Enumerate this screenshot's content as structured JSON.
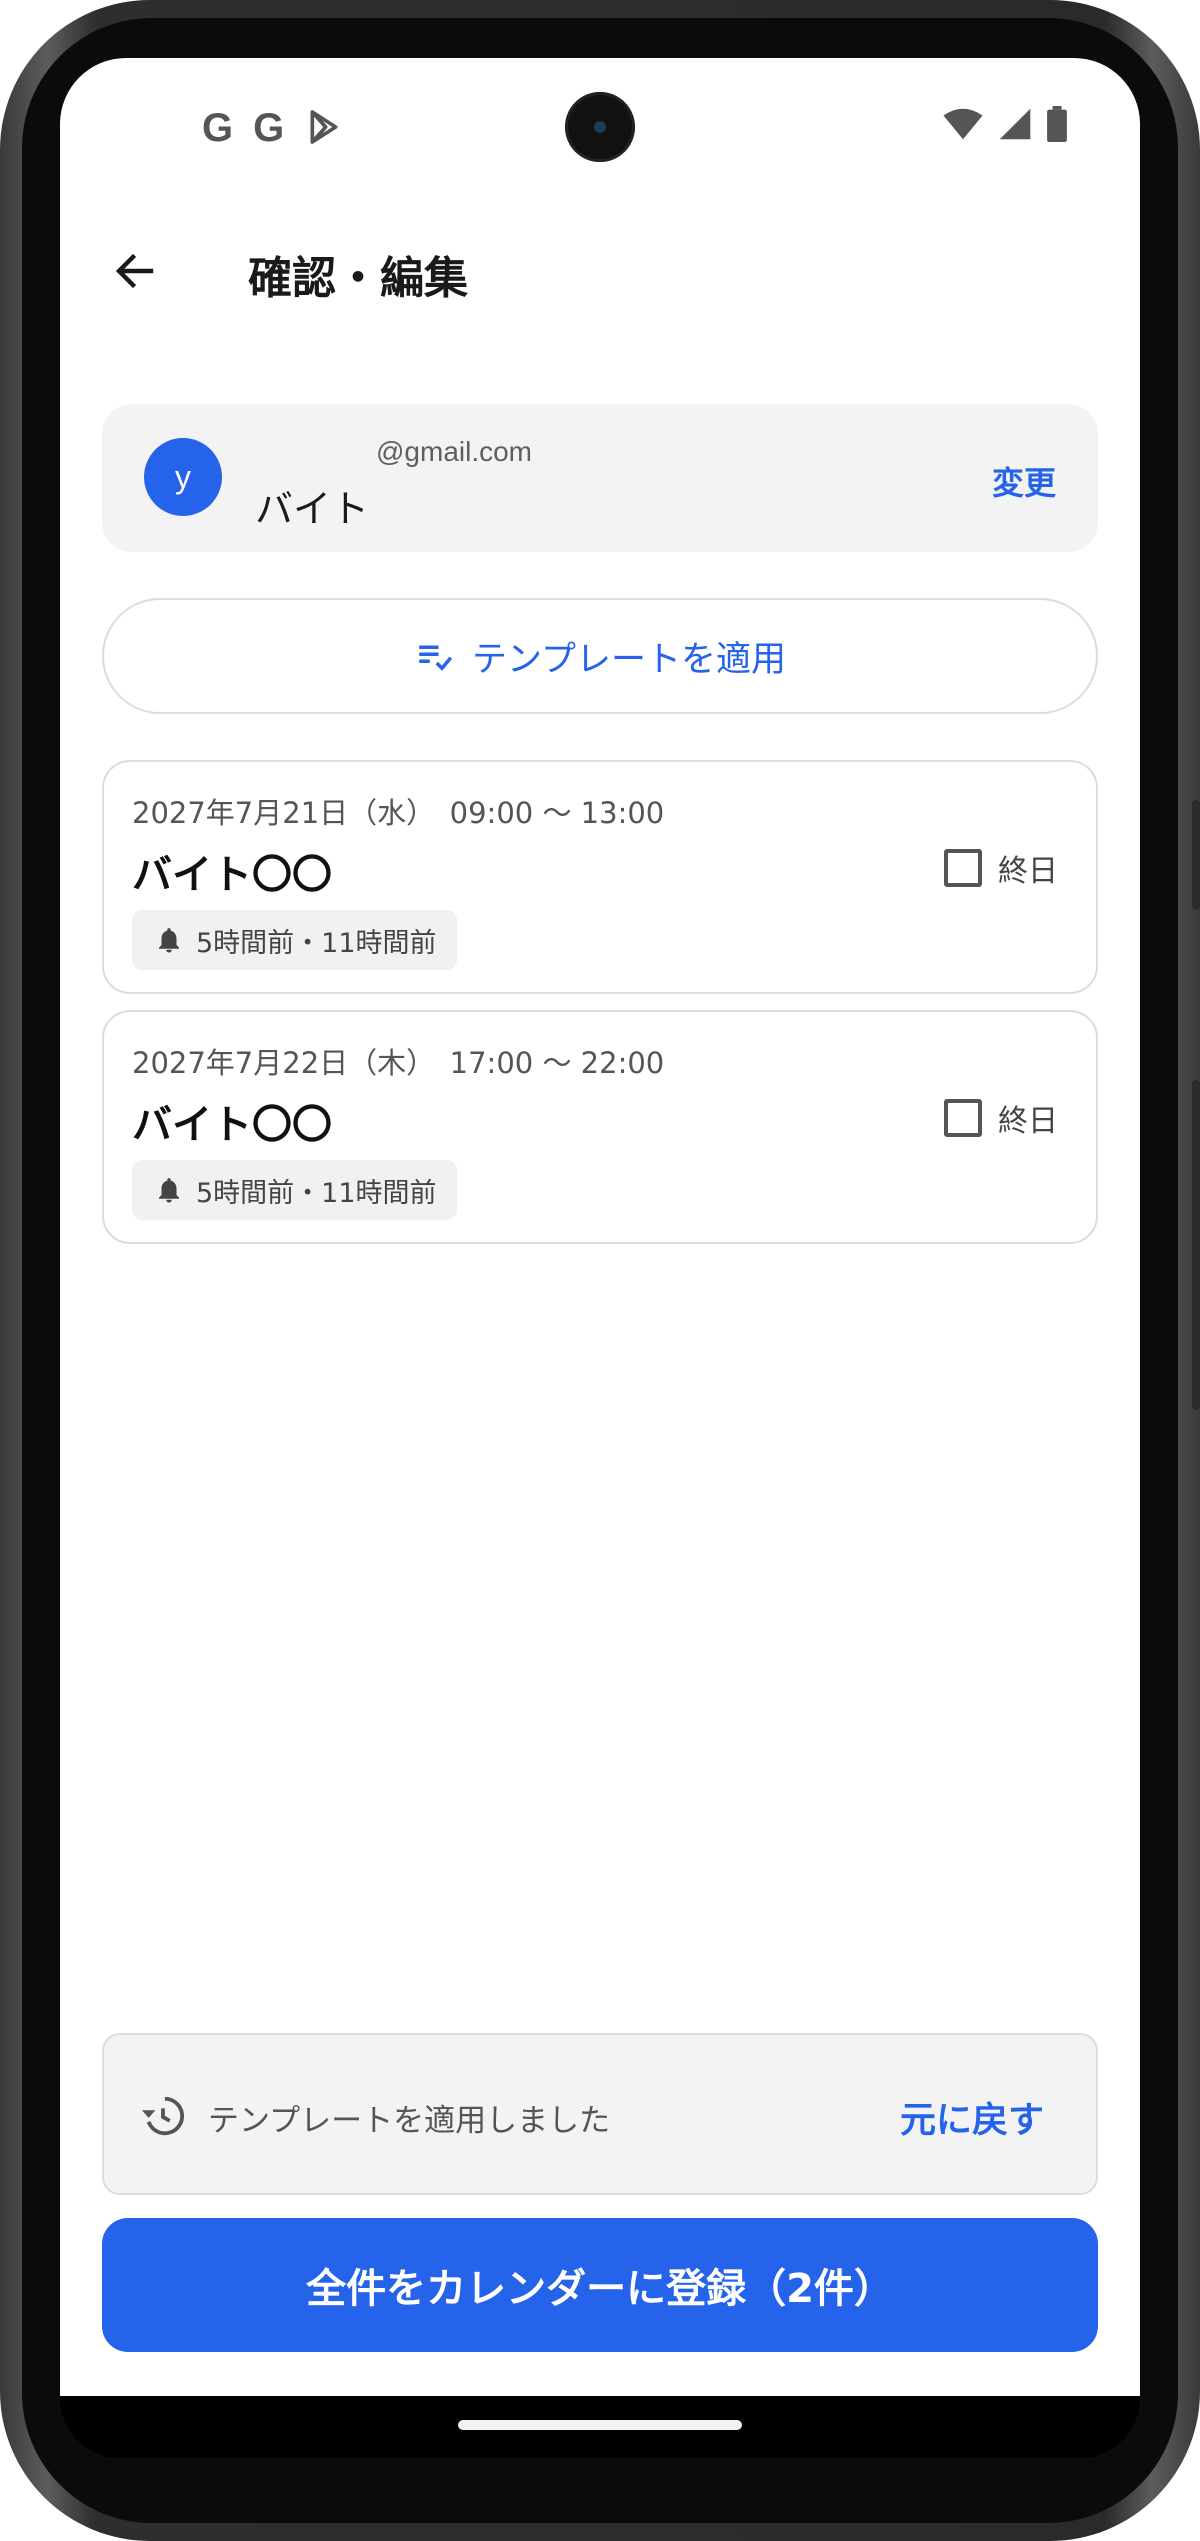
{
  "status_bar": {
    "left_icons": [
      "google-icon",
      "google-icon",
      "play-store-icon"
    ],
    "right_icons": [
      "wifi-icon",
      "signal-icon",
      "battery-icon"
    ]
  },
  "app_bar": {
    "title": "確認・編集",
    "back_icon": "arrow-back-icon"
  },
  "account": {
    "avatar_letter": "y",
    "email": "@gmail.com",
    "calendar_name": "バイト",
    "change_label": "変更"
  },
  "template_button": {
    "label": "テンプレートを適用",
    "icon": "checklist-icon"
  },
  "events": [
    {
      "datetime": "2027年7月21日（水）　09:00 〜 13:00",
      "title": "バイト〇〇",
      "allday_label": "終日",
      "allday_checked": false,
      "reminder": "5時間前・11時間前"
    },
    {
      "datetime": "2027年7月22日（木）　17:00 〜 22:00",
      "title": "バイト〇〇",
      "allday_label": "終日",
      "allday_checked": false,
      "reminder": "5時間前・11時間前"
    }
  ],
  "snackbar": {
    "message": "テンプレートを適用しました",
    "action": "元に戻す",
    "icon": "history-icon"
  },
  "primary_action": {
    "label": "全件をカレンダーに登録（2件）"
  },
  "colors": {
    "accent": "#2563eb",
    "card_bg": "#f3f3f3",
    "border": "#dcdcdc"
  }
}
